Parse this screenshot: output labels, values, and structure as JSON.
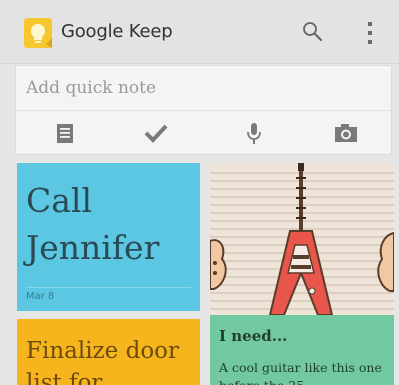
{
  "app": {
    "title": "Google Keep",
    "icon": "keep-lightbulb-icon",
    "accent": "#f7c730"
  },
  "toolbar": {
    "search_icon": "search-icon",
    "overflow_icon": "overflow-menu-icon"
  },
  "quick_note": {
    "placeholder": "Add quick note",
    "actions": [
      {
        "icon": "list-icon"
      },
      {
        "icon": "checkmark-icon"
      },
      {
        "icon": "microphone-icon"
      },
      {
        "icon": "camera-icon"
      }
    ]
  },
  "notes": [
    {
      "text": "Call Jennifer",
      "date": "Mar 8",
      "color": "#5bc7e2"
    },
    {
      "text": "Finalize door list for",
      "color": "#f7b51d"
    },
    {
      "image": "guitar-photo",
      "color": "#efe6dc"
    },
    {
      "title": "I need...",
      "body": "A cool guitar like this one before the 25",
      "color": "#72c8a0"
    }
  ]
}
